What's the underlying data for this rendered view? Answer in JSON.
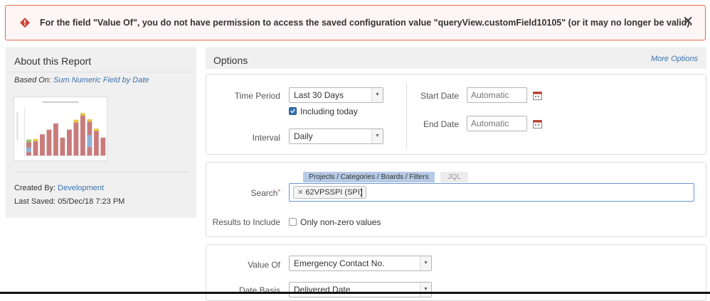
{
  "alert": {
    "message": "For the field \"Value Of\", you do not have permission to access the saved configuration value \"queryView.customField10105\" (or it may no longer be valid).",
    "close_glyph": "✕",
    "icon": "warning-icon",
    "color": "#e8684a"
  },
  "about": {
    "title": "About this Report",
    "based_on_label": "Based On:",
    "based_on_link": "Sum Numeric Field by Date",
    "created_by_label": "Created By:",
    "created_by_link": "Development",
    "last_saved": "Last Saved: 05/Dec/18 7:23 PM",
    "thumbnail": {
      "bars": [
        {
          "base": 0.28,
          "top": 0.06,
          "topColor": "#9cc06b"
        },
        {
          "base": 0.3,
          "top": 0.05,
          "topColor": "#e5c743"
        },
        {
          "base": 0.45,
          "top": 0.0,
          "topColor": "#e5c743"
        },
        {
          "base": 0.55,
          "top": 0.0,
          "topColor": "#e5c743"
        },
        {
          "base": 0.68,
          "top": 0.0,
          "topColor": "#e5c743"
        },
        {
          "base": 0.38,
          "top": 0.0,
          "topColor": "#e5c743"
        },
        {
          "base": 0.55,
          "top": 0.0,
          "topColor": "#e5c743"
        },
        {
          "base": 0.7,
          "top": 0.06,
          "topColor": "#e5c743"
        },
        {
          "base": 0.85,
          "top": 0.05,
          "topColor": "#e5c743"
        },
        {
          "base": 0.72,
          "top": 0.05,
          "topColor": "#e5c743"
        },
        {
          "base": 0.52,
          "top": 0.05,
          "topColor": "#e5c743"
        },
        {
          "base": 0.38,
          "top": 0.0,
          "topColor": "#9cc06b"
        }
      ]
    }
  },
  "options": {
    "title": "Options",
    "more_options": "More Options",
    "time_period_label": "Time Period",
    "time_period_value": "Last 30 Days",
    "including_today": "Including today",
    "interval_label": "Interval",
    "interval_value": "Daily",
    "start_date_label": "Start Date",
    "start_date_placeholder": "Automatic",
    "end_date_label": "End Date",
    "end_date_placeholder": "Automatic",
    "search_label": "Search",
    "tab_projects": "Projects / Categories / Boards / Filters",
    "tab_jql": "JQL",
    "search_token": "62VPSSPI (SPI)",
    "results_label": "Results to Include",
    "non_zero": "Only non-zero values",
    "value_of_label": "Value Of",
    "value_of_value": "Emergency Contact No.",
    "date_basis_label": "Date Basis",
    "date_basis_value": "Delivered Date"
  },
  "colors": {
    "link": "#3b73af",
    "panel_bg": "#f0f0f0",
    "bar_main": "#c97b7b",
    "bar_blue": "#8fb2d8"
  }
}
